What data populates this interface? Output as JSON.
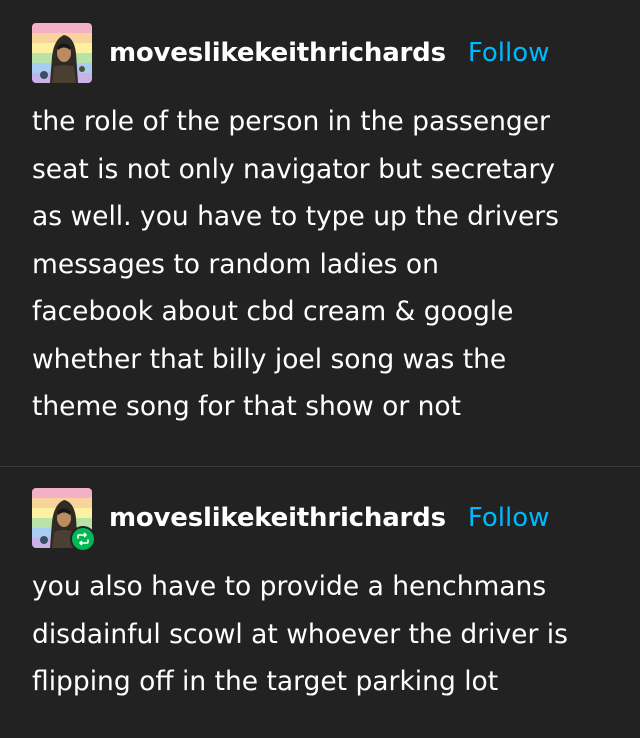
{
  "colors": {
    "background": "#222222",
    "text": "#ffffff",
    "follow_link": "#00b8ff",
    "reblog_badge": "#00b956",
    "divider": "#3a3a3a"
  },
  "posts": [
    {
      "username": "moveslikekeithrichards",
      "follow_label": "Follow",
      "avatar_icon": "pride-flag-hooded-figure-avatar",
      "reblog": false,
      "text": "the role of the person in the passenger\nseat is not only navigator but secretary\nas well. you have to type up the drivers\nmessages to random ladies on\nfacebook about cbd cream & google\nwhether that billy joel song was the\ntheme song for that show or not"
    },
    {
      "username": "moveslikekeithrichards",
      "follow_label": "Follow",
      "avatar_icon": "pride-flag-hooded-figure-avatar",
      "reblog": true,
      "reblog_icon": "reblog-icon",
      "text": "you also have to provide a henchmans\ndisdainful scowl at whoever the driver is\nflipping off in the target parking lot"
    }
  ]
}
